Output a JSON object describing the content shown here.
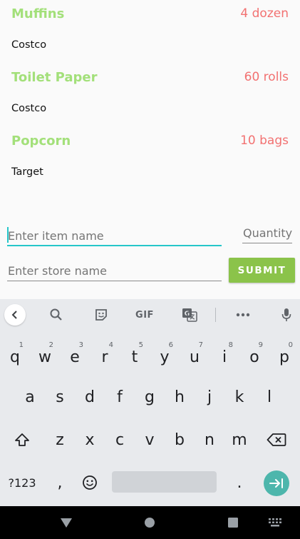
{
  "items": [
    {
      "name": "Muffins",
      "quantity": "4 dozen",
      "store": "Costco"
    },
    {
      "name": "Toilet Paper",
      "quantity": "60 rolls",
      "store": "Costco"
    },
    {
      "name": "Popcorn",
      "quantity": "10 bags",
      "store": "Target"
    }
  ],
  "form": {
    "item_placeholder": "Enter item name",
    "quantity_placeholder": "Quantity",
    "store_placeholder": "Enter store name",
    "submit_label": "SUBMIT"
  },
  "keyboard": {
    "toolbar": {
      "gif_label": "GIF"
    },
    "row1": [
      {
        "label": "q",
        "hint": "1"
      },
      {
        "label": "w",
        "hint": "2"
      },
      {
        "label": "e",
        "hint": "3"
      },
      {
        "label": "r",
        "hint": "4"
      },
      {
        "label": "t",
        "hint": "5"
      },
      {
        "label": "y",
        "hint": "6"
      },
      {
        "label": "u",
        "hint": "7"
      },
      {
        "label": "i",
        "hint": "8"
      },
      {
        "label": "o",
        "hint": "9"
      },
      {
        "label": "p",
        "hint": "0"
      }
    ],
    "row2": [
      "a",
      "s",
      "d",
      "f",
      "g",
      "h",
      "j",
      "k",
      "l"
    ],
    "row3": [
      "z",
      "x",
      "c",
      "v",
      "b",
      "n",
      "m"
    ],
    "symbols_label": "?123",
    "comma_label": ",",
    "period_label": "."
  },
  "colors": {
    "item_name": "#a3e07a",
    "item_quantity": "#f27171",
    "accent": "#26c6c9",
    "submit": "#8bc34a",
    "enter_key": "#4db6ac"
  }
}
